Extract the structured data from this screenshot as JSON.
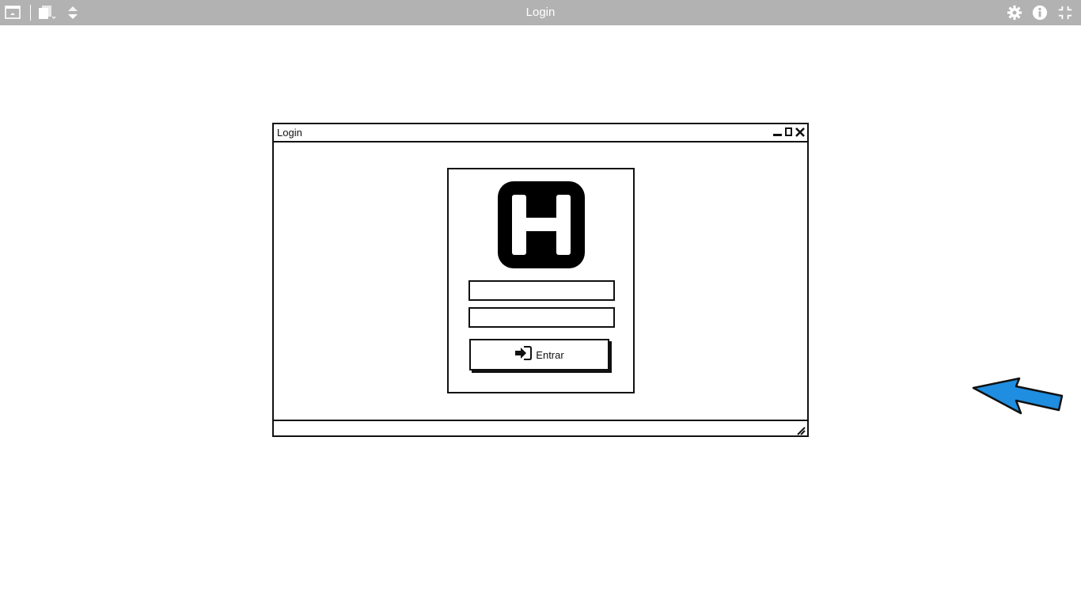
{
  "appbar": {
    "title": "Login",
    "icons": [
      "window-icon",
      "pages-icon",
      "sort-arrows-icon",
      "gear-icon",
      "info-icon",
      "collapse-icon"
    ]
  },
  "window": {
    "title": "Login",
    "controls": [
      "minimize-icon",
      "maximize-icon",
      "close-icon"
    ]
  },
  "login": {
    "logo": "hospital-logo-icon",
    "username_value": "",
    "password_value": "",
    "submit_label": "Entrar",
    "submit_icon": "sign-in-icon"
  },
  "colors": {
    "appbar_bg": "#b2b2b2",
    "stroke": "#111111",
    "arrow_fill": "#1f8ee0"
  }
}
